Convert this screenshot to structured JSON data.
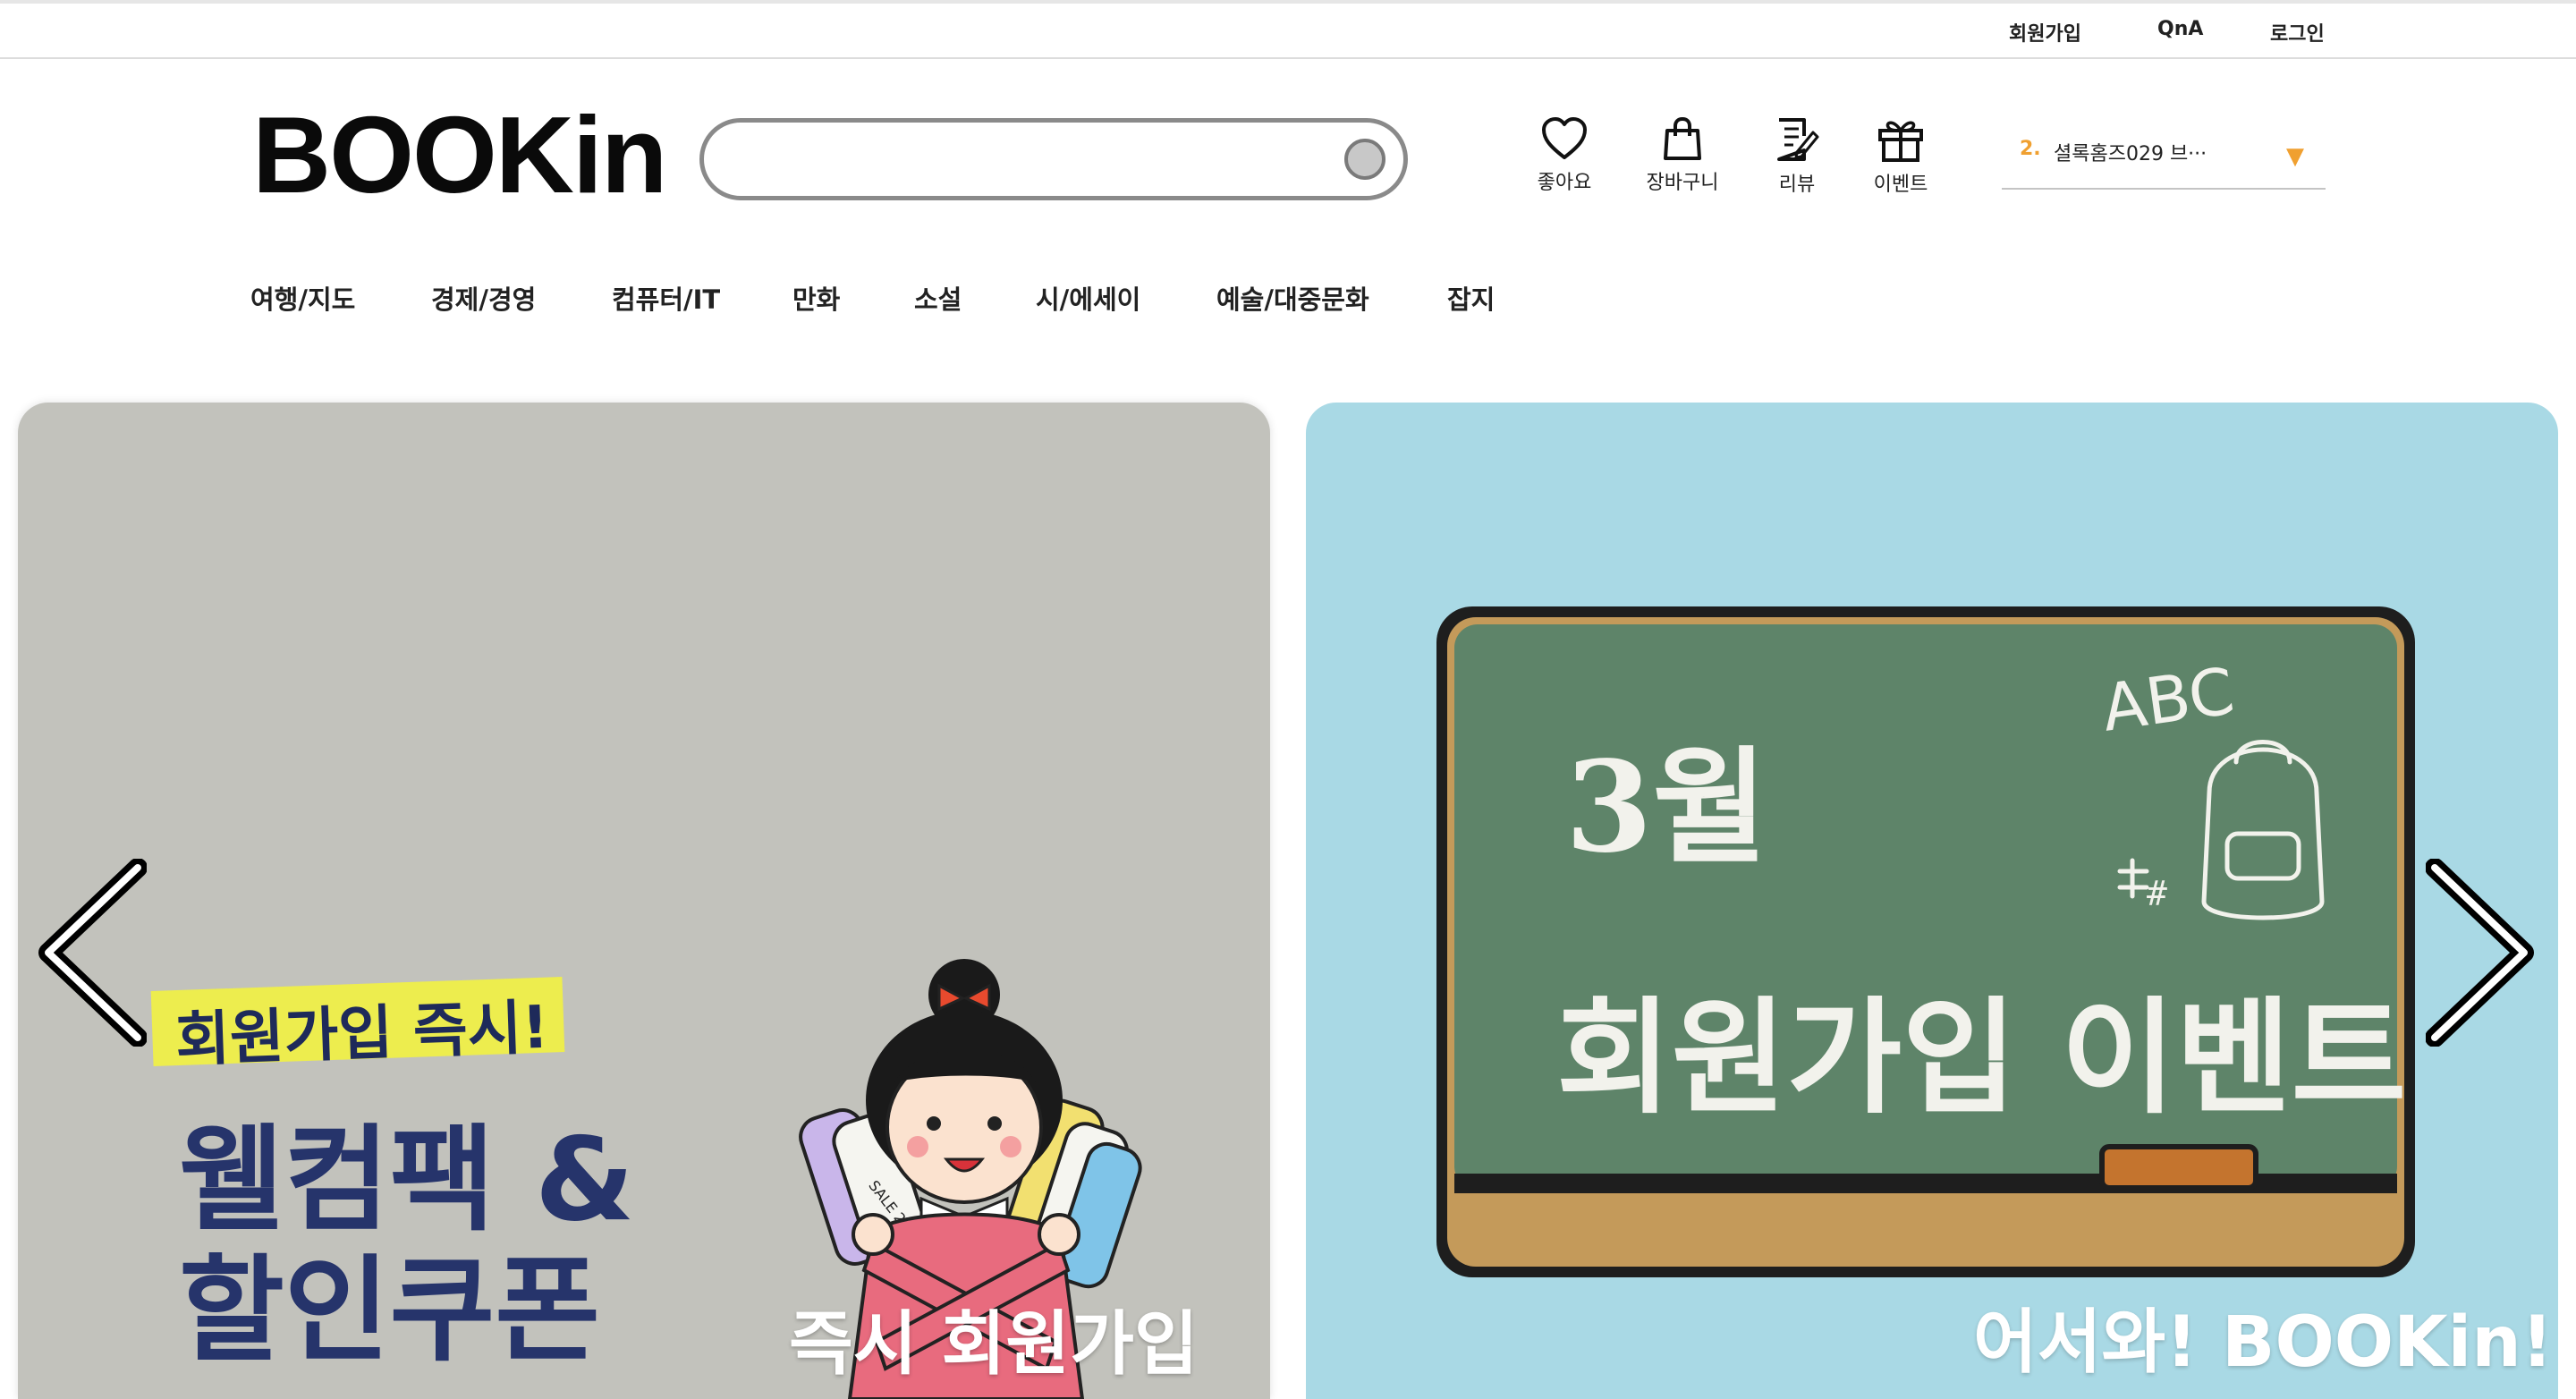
{
  "topbar": {
    "links": [
      "회원가입",
      "QnA",
      "로그인"
    ]
  },
  "logo": "BOOKin",
  "search": {
    "value": "",
    "placeholder": ""
  },
  "header_icons": [
    {
      "icon": "heart-icon",
      "label": "좋아요"
    },
    {
      "icon": "shopping-bag-icon",
      "label": "장바구니"
    },
    {
      "icon": "review-note-icon",
      "label": "리뷰"
    },
    {
      "icon": "gift-icon",
      "label": "이벤트"
    }
  ],
  "ranking": {
    "number": "2.",
    "title": "셜록홈즈029 브···",
    "arrow": "▼"
  },
  "nav": [
    "여행/지도",
    "경제/경영",
    "컴퓨터/IT",
    "만화",
    "소설",
    "시/에세이",
    "예술/대중문화",
    "잡지"
  ],
  "banners": {
    "left": {
      "highlight": "회원가입 즉시!",
      "line1": "웰컴팩 &",
      "line2": "할인쿠폰",
      "caption": "즉시 회원가입",
      "coupon_text": "SALE 20% 쿠폰"
    },
    "right": {
      "board_line1": "3월",
      "board_line2": "회원가입 이벤트",
      "board_extra": "ABC",
      "caption": "어서와! BOOKin!"
    }
  },
  "colors": {
    "left_banner_bg": "#c2c2bc",
    "right_banner_bg": "#a9d9e5",
    "chalkboard": "#5e8469",
    "accent_orange": "#f0a030",
    "highlight_yellow": "#eded4e",
    "navy_text": "#26346b"
  }
}
